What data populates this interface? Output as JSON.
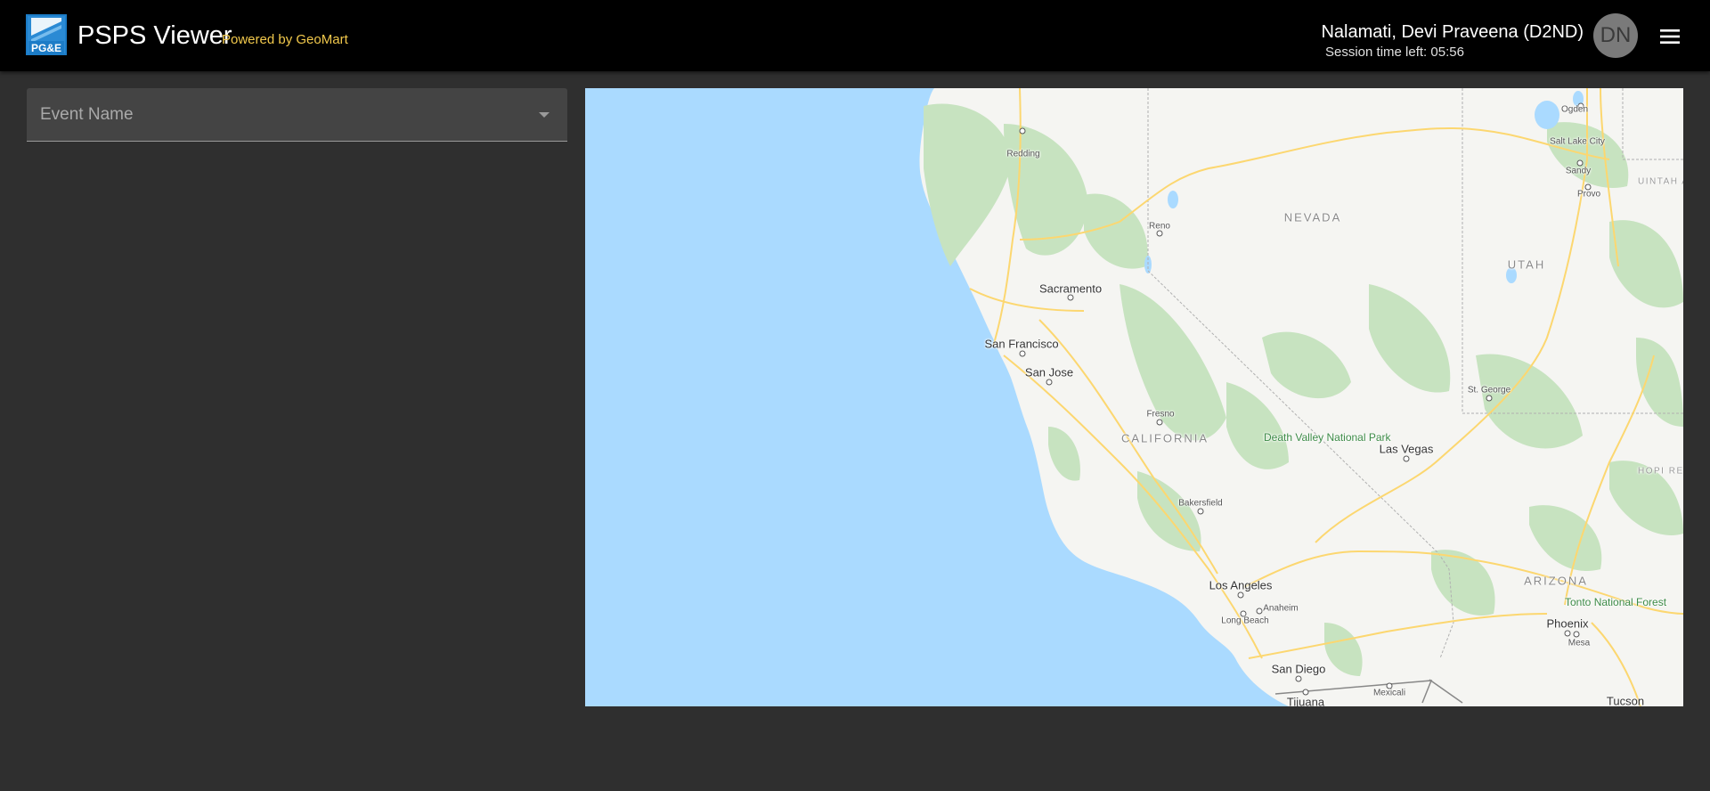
{
  "header": {
    "logo_text": "PG&E",
    "app_title": "PSPS Viewer",
    "powered_by": "Powered by GeoMart",
    "user_name": "Nalamati, Devi Praveena (D2ND)",
    "session_text": "Session time left: 05:56",
    "avatar_initials": "DN",
    "menu_icon": "hamburger-menu-icon"
  },
  "filters": {
    "event_name_label": "Event Name",
    "dropdown_icon": "caret-down-icon"
  },
  "map": {
    "states": {
      "nevada": "NEVADA",
      "utah": "UTAH",
      "california": "CALIFORNIA",
      "arizona": "ARIZONA"
    },
    "cities": {
      "redding": "Redding",
      "reno": "Reno",
      "sacramento": "Sacramento",
      "san_francisco": "San Francisco",
      "san_jose": "San Jose",
      "fresno": "Fresno",
      "bakersfield": "Bakersfield",
      "los_angeles": "Los Angeles",
      "anaheim": "Anaheim",
      "long_beach": "Long Beach",
      "san_diego": "San Diego",
      "tijuana": "Tijuana",
      "mexicali": "Mexicali",
      "las_vegas": "Las Vegas",
      "st_george": "St. George",
      "phoenix": "Phoenix",
      "mesa": "Mesa",
      "tucson": "Tucson",
      "ogden": "Ogden",
      "salt_lake_city": "Salt Lake City",
      "sandy": "Sandy",
      "provo": "Provo"
    },
    "parks": {
      "death_valley": "Death Valley National Park",
      "tonto": "Tonto National Forest"
    },
    "regions": {
      "uintah": "UINTAH AND OURAY RESERVATION",
      "hopi": "HOPI RESERVATION"
    },
    "colors": {
      "water": "#aadaff",
      "land": "#f5f5f2",
      "forest": "#c7e3c0",
      "roads": "#fcd770"
    }
  }
}
